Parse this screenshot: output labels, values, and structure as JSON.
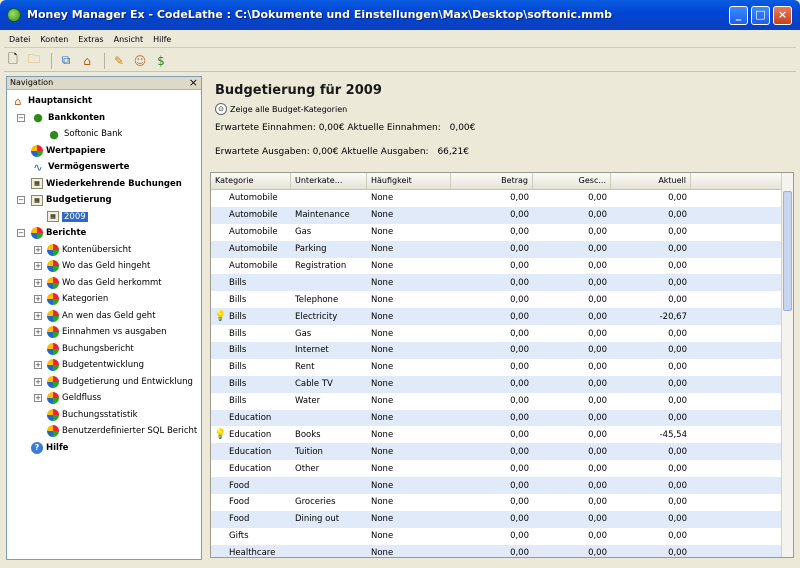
{
  "window": {
    "title": "Money Manager Ex - CodeLathe : C:\\Dokumente und Einstellungen\\Max\\Desktop\\softonic.mmb"
  },
  "menu": [
    "Datei",
    "Konten",
    "Extras",
    "Ansicht",
    "Hilfe"
  ],
  "toolbar": {
    "icons": [
      "new-file-icon",
      "open-folder-icon",
      "accounts-icon",
      "home-icon",
      "edit-icon",
      "users-icon",
      "money-icon"
    ]
  },
  "navigation": {
    "title": "Navigation",
    "close": "×",
    "nodes": [
      {
        "label": "Hauptansicht",
        "bold": true
      },
      {
        "label": "Bankkonten",
        "bold": true
      },
      {
        "label": "Softonic Bank",
        "bold": false
      },
      {
        "label": "Wertpapiere",
        "bold": true
      },
      {
        "label": "Vermögenswerte",
        "bold": true
      },
      {
        "label": "Wiederkehrende Buchungen",
        "bold": true
      },
      {
        "label": "Budgetierung",
        "bold": true
      },
      {
        "label": "2009",
        "bold": false,
        "selected": true
      },
      {
        "label": "Berichte",
        "bold": true
      },
      {
        "label": "Kontenübersicht",
        "bold": false
      },
      {
        "label": "Wo das Geld hingeht",
        "bold": false
      },
      {
        "label": "Wo das Geld herkommt",
        "bold": false
      },
      {
        "label": "Kategorien",
        "bold": false
      },
      {
        "label": "An wen das Geld geht",
        "bold": false
      },
      {
        "label": "Einnahmen vs ausgaben",
        "bold": false
      },
      {
        "label": "Buchungsbericht",
        "bold": false
      },
      {
        "label": "Budgetentwicklung",
        "bold": false
      },
      {
        "label": "Budgetierung und Entwicklung",
        "bold": false
      },
      {
        "label": "Geldfluss",
        "bold": false
      },
      {
        "label": "Buchungsstatistik",
        "bold": false
      },
      {
        "label": "Benutzerdefinierter SQL Bericht",
        "bold": false
      },
      {
        "label": "Hilfe",
        "bold": true
      }
    ]
  },
  "budget": {
    "title": "Budgetierung für 2009",
    "show_all": "Zeige alle Budget-Kategorien",
    "expected_income_label": "Erwartete Einnahmen:",
    "expected_income": "0,00€",
    "actual_income_label": "Aktuelle Einnahmen:",
    "actual_income": "0,00€",
    "expected_expenses_label": "Erwartete Ausgaben:",
    "expected_expenses": "0,00€",
    "actual_expenses_label": "Aktuelle Ausgaben:",
    "actual_expenses": "66,21€"
  },
  "table": {
    "columns": [
      "Kategorie",
      "Unterkate...",
      "Häufigkeit",
      "Betrag",
      "Gesc...",
      "Aktuell"
    ],
    "rows": [
      {
        "cat": "Automobile",
        "sub": "",
        "freq": "None",
        "amount": "0,00",
        "est": "0,00",
        "actual": "0,00",
        "warn": false
      },
      {
        "cat": "Automobile",
        "sub": "Maintenance",
        "freq": "None",
        "amount": "0,00",
        "est": "0,00",
        "actual": "0,00",
        "warn": false
      },
      {
        "cat": "Automobile",
        "sub": "Gas",
        "freq": "None",
        "amount": "0,00",
        "est": "0,00",
        "actual": "0,00",
        "warn": false
      },
      {
        "cat": "Automobile",
        "sub": "Parking",
        "freq": "None",
        "amount": "0,00",
        "est": "0,00",
        "actual": "0,00",
        "warn": false
      },
      {
        "cat": "Automobile",
        "sub": "Registration",
        "freq": "None",
        "amount": "0,00",
        "est": "0,00",
        "actual": "0,00",
        "warn": false
      },
      {
        "cat": "Bills",
        "sub": "",
        "freq": "None",
        "amount": "0,00",
        "est": "0,00",
        "actual": "0,00",
        "warn": false
      },
      {
        "cat": "Bills",
        "sub": "Telephone",
        "freq": "None",
        "amount": "0,00",
        "est": "0,00",
        "actual": "0,00",
        "warn": false
      },
      {
        "cat": "Bills",
        "sub": "Electricity",
        "freq": "None",
        "amount": "0,00",
        "est": "0,00",
        "actual": "-20,67",
        "warn": true
      },
      {
        "cat": "Bills",
        "sub": "Gas",
        "freq": "None",
        "amount": "0,00",
        "est": "0,00",
        "actual": "0,00",
        "warn": false
      },
      {
        "cat": "Bills",
        "sub": "Internet",
        "freq": "None",
        "amount": "0,00",
        "est": "0,00",
        "actual": "0,00",
        "warn": false
      },
      {
        "cat": "Bills",
        "sub": "Rent",
        "freq": "None",
        "amount": "0,00",
        "est": "0,00",
        "actual": "0,00",
        "warn": false
      },
      {
        "cat": "Bills",
        "sub": "Cable TV",
        "freq": "None",
        "amount": "0,00",
        "est": "0,00",
        "actual": "0,00",
        "warn": false
      },
      {
        "cat": "Bills",
        "sub": "Water",
        "freq": "None",
        "amount": "0,00",
        "est": "0,00",
        "actual": "0,00",
        "warn": false
      },
      {
        "cat": "Education",
        "sub": "",
        "freq": "None",
        "amount": "0,00",
        "est": "0,00",
        "actual": "0,00",
        "warn": false
      },
      {
        "cat": "Education",
        "sub": "Books",
        "freq": "None",
        "amount": "0,00",
        "est": "0,00",
        "actual": "-45,54",
        "warn": true
      },
      {
        "cat": "Education",
        "sub": "Tuition",
        "freq": "None",
        "amount": "0,00",
        "est": "0,00",
        "actual": "0,00",
        "warn": false
      },
      {
        "cat": "Education",
        "sub": "Other",
        "freq": "None",
        "amount": "0,00",
        "est": "0,00",
        "actual": "0,00",
        "warn": false
      },
      {
        "cat": "Food",
        "sub": "",
        "freq": "None",
        "amount": "0,00",
        "est": "0,00",
        "actual": "0,00",
        "warn": false
      },
      {
        "cat": "Food",
        "sub": "Groceries",
        "freq": "None",
        "amount": "0,00",
        "est": "0,00",
        "actual": "0,00",
        "warn": false
      },
      {
        "cat": "Food",
        "sub": "Dining out",
        "freq": "None",
        "amount": "0,00",
        "est": "0,00",
        "actual": "0,00",
        "warn": false
      },
      {
        "cat": "Gifts",
        "sub": "",
        "freq": "None",
        "amount": "0,00",
        "est": "0,00",
        "actual": "0,00",
        "warn": false
      },
      {
        "cat": "Healthcare",
        "sub": "",
        "freq": "None",
        "amount": "0,00",
        "est": "0,00",
        "actual": "0,00",
        "warn": false
      }
    ]
  }
}
